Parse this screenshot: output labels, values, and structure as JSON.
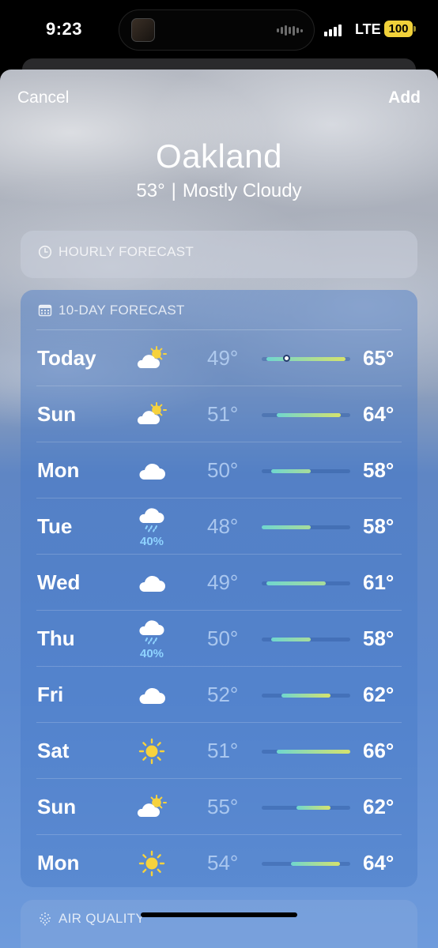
{
  "status_bar": {
    "time": "9:23",
    "network": "LTE",
    "battery": "100",
    "battery_color": "#f1d13a",
    "signal_icon": "cellular-signal-icon"
  },
  "header": {
    "cancel_label": "Cancel",
    "add_label": "Add",
    "city": "Oakland",
    "current_temp": "53°",
    "separator": "|",
    "condition": "Mostly Cloudy"
  },
  "hourly": {
    "icon": "clock-icon",
    "title": "HOURLY FORECAST"
  },
  "ten_day": {
    "icon": "calendar-icon",
    "title": "10-DAY FORECAST",
    "range_min": 48,
    "range_max": 66,
    "current_temp": 53,
    "days": [
      {
        "day": "Today",
        "icon": "partly-sunny-icon",
        "precip": "",
        "low": "49°",
        "high": "65°",
        "low_val": 49,
        "high_val": 65
      },
      {
        "day": "Sun",
        "icon": "partly-sunny-icon",
        "precip": "",
        "low": "51°",
        "high": "64°",
        "low_val": 51,
        "high_val": 64
      },
      {
        "day": "Mon",
        "icon": "cloud-icon",
        "precip": "",
        "low": "50°",
        "high": "58°",
        "low_val": 50,
        "high_val": 58
      },
      {
        "day": "Tue",
        "icon": "rain-cloud-icon",
        "precip": "40%",
        "low": "48°",
        "high": "58°",
        "low_val": 48,
        "high_val": 58
      },
      {
        "day": "Wed",
        "icon": "cloud-icon",
        "precip": "",
        "low": "49°",
        "high": "61°",
        "low_val": 49,
        "high_val": 61
      },
      {
        "day": "Thu",
        "icon": "rain-cloud-icon",
        "precip": "40%",
        "low": "50°",
        "high": "58°",
        "low_val": 50,
        "high_val": 58
      },
      {
        "day": "Fri",
        "icon": "cloud-icon",
        "precip": "",
        "low": "52°",
        "high": "62°",
        "low_val": 52,
        "high_val": 62
      },
      {
        "day": "Sat",
        "icon": "sun-icon",
        "precip": "",
        "low": "51°",
        "high": "66°",
        "low_val": 51,
        "high_val": 66
      },
      {
        "day": "Sun",
        "icon": "partly-sunny-icon",
        "precip": "",
        "low": "55°",
        "high": "62°",
        "low_val": 55,
        "high_val": 62
      },
      {
        "day": "Mon",
        "icon": "sun-icon",
        "precip": "",
        "low": "54°",
        "high": "64°",
        "low_val": 54,
        "high_val": 64
      }
    ]
  },
  "air_quality": {
    "icon": "air-quality-icon",
    "title": "AIR QUALITY"
  },
  "colors": {
    "cool": "#6fd6cf",
    "mild": "#a8dc9a",
    "warm": "#d6e36c",
    "precip": "#8fd3ff"
  }
}
